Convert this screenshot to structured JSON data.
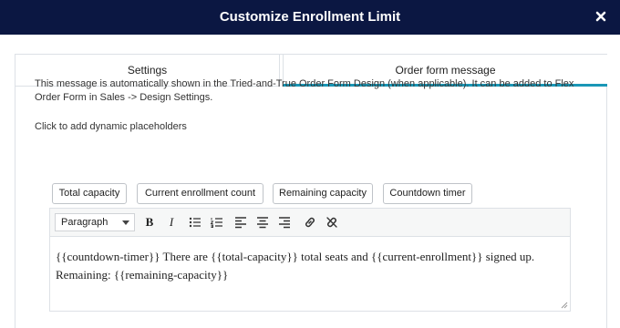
{
  "dialog": {
    "title": "Customize Enrollment Limit"
  },
  "tabs": [
    {
      "label": "Settings",
      "active": false
    },
    {
      "label": "Order form message",
      "active": true
    }
  ],
  "message": {
    "description": "This message is automatically shown in the Tried-and-True Order Form Design (when applicable). It can be added to Flex Order Form in Sales -> Design Settings.",
    "hint": "Click to add dynamic placeholders"
  },
  "placeholders": [
    "Total capacity",
    "Current enrollment count",
    "Remaining capacity",
    "Countdown timer"
  ],
  "editor": {
    "format_value": "Paragraph",
    "content": "{{countdown-timer}} There are {{total-capacity}} total seats and {{current-enrollment}} signed up. Remaining: {{remaining-capacity}}"
  },
  "colors": {
    "titlebar": "#0b1742",
    "active_tab_underline": "#1a97b6"
  },
  "icons": {
    "close": "close-icon",
    "bold": "bold-icon",
    "italic": "italic-icon",
    "bullet_list": "bullet-list-icon",
    "numbered_list": "numbered-list-icon",
    "align_left": "align-left-icon",
    "align_center": "align-center-icon",
    "align_right": "align-right-icon",
    "link": "link-icon",
    "unlink": "unlink-icon"
  }
}
